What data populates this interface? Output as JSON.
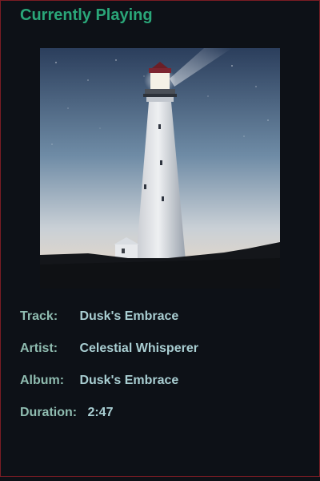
{
  "header": {
    "title": "Currently Playing"
  },
  "artwork": {
    "icon": "lighthouse-album-art"
  },
  "track_info": {
    "track_label": "Track:",
    "track_value": "Dusk's Embrace",
    "artist_label": "Artist:",
    "artist_value": "Celestial Whisperer",
    "album_label": "Album:",
    "album_value": "Dusk's Embrace",
    "duration_label": "Duration:",
    "duration_value": "2:47"
  },
  "colors": {
    "background": "#0d1117",
    "accent": "#2aa779",
    "label": "#8fbcb0",
    "value": "#a9ced2",
    "border": "#7a1c24"
  }
}
